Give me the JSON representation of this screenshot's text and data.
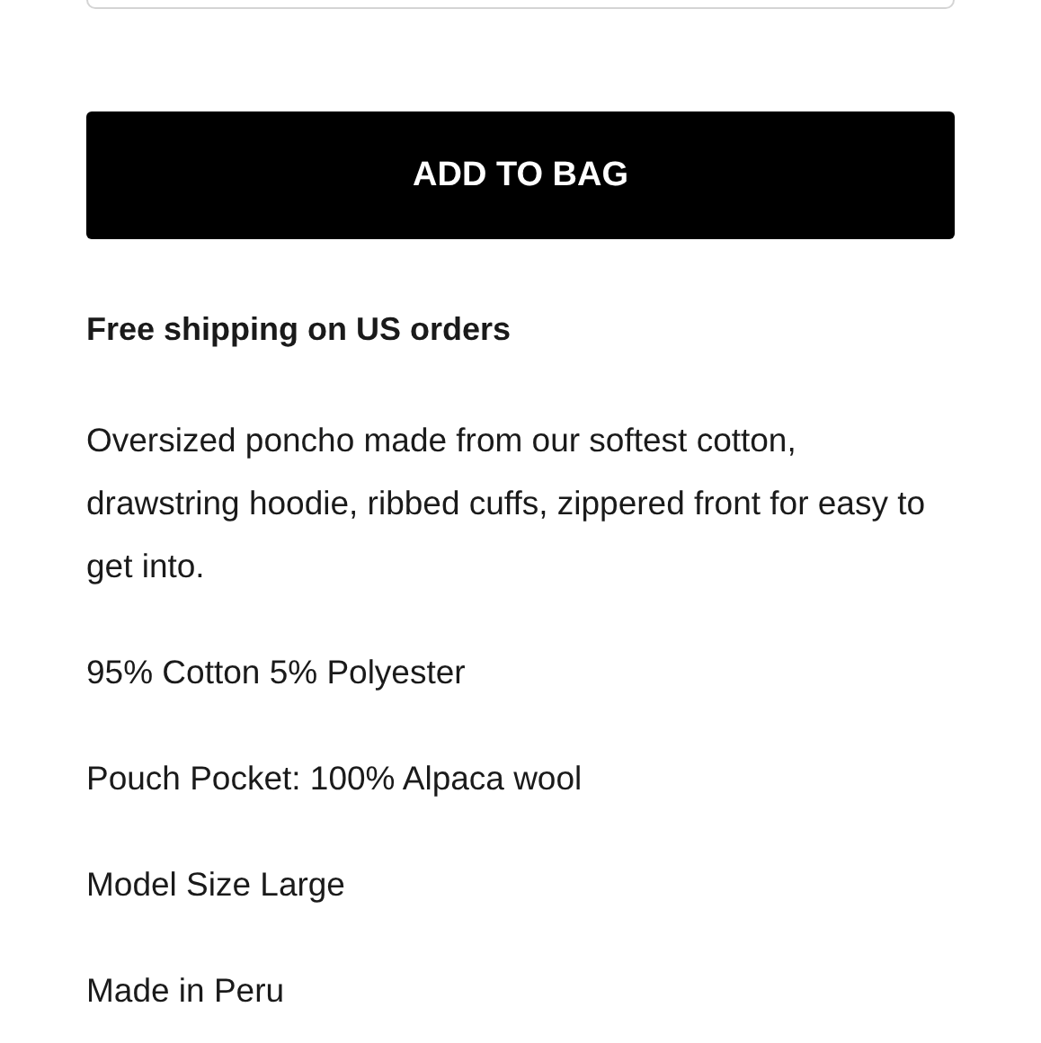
{
  "button": {
    "label": "ADD TO BAG"
  },
  "shipping_note": "Free shipping on US orders",
  "description": [
    "Oversized poncho made from our softest cotton, drawstring hoodie, ribbed cuffs, zippered front for easy to get into.",
    "95% Cotton 5% Polyester",
    "Pouch Pocket: 100% Alpaca wool",
    "Model Size Large",
    "Made in Peru"
  ]
}
